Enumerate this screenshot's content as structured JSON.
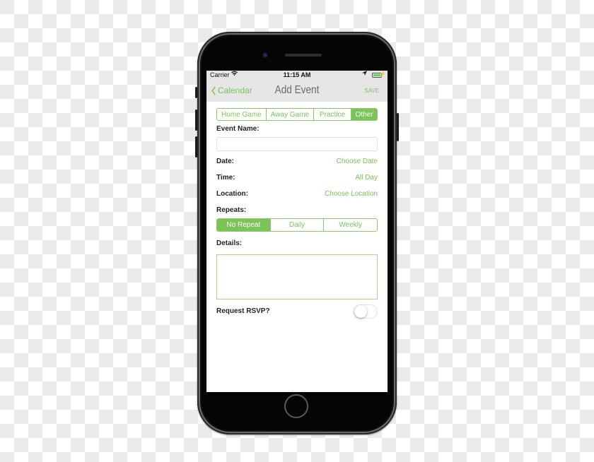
{
  "status_bar": {
    "carrier": "Carrier",
    "wifi_icon": "wifi-icon",
    "time": "11:15 AM",
    "location_icon": "location-arrow-icon",
    "battery_icon": "battery-icon",
    "battery_level_percent": 100,
    "charging_icon": "charging-bolt-icon"
  },
  "nav": {
    "back_icon": "chevron-left-icon",
    "back_label": "Calendar",
    "title": "Add Event",
    "save_label": "SAVE"
  },
  "event_type": {
    "options": [
      "Home Game",
      "Away Game",
      "Practice",
      "Other"
    ],
    "selected": "Other"
  },
  "form": {
    "event_name_label": "Event Name:",
    "event_name_value": "",
    "date_label": "Date:",
    "date_value": "Choose Date",
    "time_label": "Time:",
    "time_value": "All Day",
    "location_label": "Location:",
    "location_value": "Choose Location",
    "repeats_label": "Repeats:",
    "repeat_options": [
      "No Repeat",
      "Daily",
      "Weekly"
    ],
    "repeat_selected": "No Repeat",
    "details_label": "Details:",
    "details_value": "",
    "rsvp_label": "Request RSVP?",
    "rsvp_on": false
  },
  "colors": {
    "accent": "#7cc35a",
    "navbar_bg": "#e6e6e6",
    "phone_body": "#050505"
  }
}
